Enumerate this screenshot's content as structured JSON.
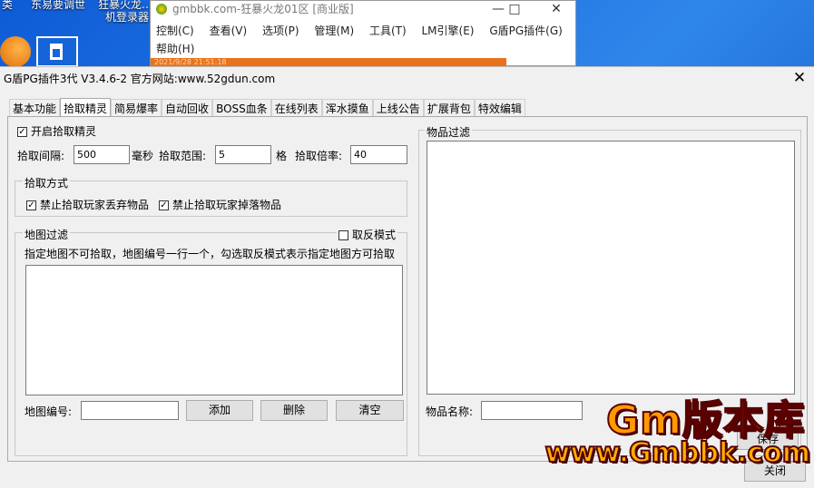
{
  "desktop": {
    "labels": [
      "类",
      "东易要调世",
      "狂暴火龙…",
      "机登录器"
    ]
  },
  "bg_window": {
    "title": "gmbbk.com-狂暴火龙01区 [商业版]",
    "menu_row1": [
      "控制(C)",
      "查看(V)",
      "选项(P)",
      "管理(M)",
      "工具(T)",
      "LM引擎(E)",
      "G盾PG插件(G)"
    ],
    "menu_row2": "帮助(H)",
    "status_text": "2021/9/28 21:51:18",
    "min_glyph": "—",
    "max_glyph": "□",
    "close_glyph": "✕"
  },
  "dialog": {
    "title": "G盾PG插件3代 V3.4.6-2  官方网站:www.52gdun.com",
    "close_glyph": "✕",
    "tabs": [
      "基本功能",
      "拾取精灵",
      "简易爆率",
      "自动回收",
      "BOSS血条",
      "在线列表",
      "浑水摸鱼",
      "上线公告",
      "扩展背包",
      "特效编辑"
    ],
    "active_tab_index": 1,
    "enable_pickup": {
      "label": "开启拾取精灵",
      "checked": true
    },
    "interval": {
      "label": "拾取间隔:",
      "value": "500",
      "unit": "毫秒"
    },
    "range": {
      "label": "拾取范围:",
      "value": "5",
      "unit": "格"
    },
    "rate": {
      "label": "拾取倍率:",
      "value": "40"
    },
    "pickup_method": {
      "title": "拾取方式",
      "opt1": {
        "label": "禁止拾取玩家丢弃物品",
        "checked": true
      },
      "opt2": {
        "label": "禁止拾取玩家掉落物品",
        "checked": true
      }
    },
    "map_filter": {
      "title": "地图过滤",
      "invert": {
        "label": "取反模式",
        "checked": false
      },
      "hint": "指定地图不可拾取，地图编号一行一个，勾选取反模式表示指定地图方可拾取",
      "map_id_label": "地图编号:",
      "map_id_value": "",
      "add": "添加",
      "delete": "删除",
      "clear": "清空"
    },
    "item_filter": {
      "title": "物品过滤",
      "item_name_label": "物品名称:",
      "item_name_value": ""
    },
    "save": "保存",
    "close": "关闭"
  },
  "watermark": {
    "main": "Gm版本库",
    "sub": "www.Gmbbk.com"
  },
  "check_glyph": "✓"
}
